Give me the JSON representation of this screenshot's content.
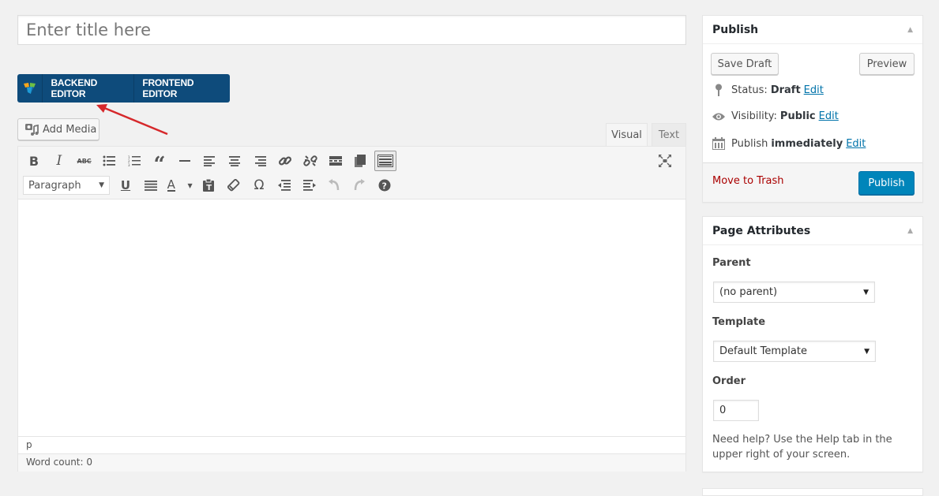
{
  "title": {
    "placeholder": "Enter title here",
    "value": ""
  },
  "composer": {
    "backend_label": "BACKEND EDITOR",
    "frontend_label": "FRONTEND EDITOR",
    "brand_color": "#0e4b7b"
  },
  "media": {
    "add_media_label": "Add Media"
  },
  "editor_tabs": [
    {
      "label": "Visual",
      "active": true
    },
    {
      "label": "Text",
      "active": false
    }
  ],
  "toolbar": {
    "row1": [
      "bold",
      "italic",
      "strikethrough",
      "bulleted-list",
      "numbered-list",
      "blockquote",
      "horizontal-line",
      "align-left",
      "align-center",
      "align-right",
      "insert-link",
      "remove-link",
      "read-more",
      "copy",
      "toolbar-toggle"
    ],
    "row2": [
      "underline",
      "justify",
      "text-color",
      "paste-as-text",
      "clear-formatting",
      "special-character",
      "decrease-indent",
      "increase-indent",
      "undo",
      "redo",
      "help"
    ],
    "format_select_value": "Paragraph"
  },
  "editor": {
    "content": "",
    "path": "p",
    "word_count_label": "Word count: 0"
  },
  "publish": {
    "title": "Publish",
    "save_draft_label": "Save Draft",
    "preview_label": "Preview",
    "status_label": "Status:",
    "status_value": "Draft",
    "visibility_label": "Visibility:",
    "visibility_value": "Public",
    "schedule_label": "Publish",
    "schedule_value": "immediately",
    "edit_label": "Edit",
    "trash_label": "Move to Trash",
    "publish_label": "Publish",
    "publish_color": "#0085ba",
    "trash_color": "#a00000"
  },
  "page_attributes": {
    "title": "Page Attributes",
    "parent_label": "Parent",
    "parent_value": "(no parent)",
    "template_label": "Template",
    "template_value": "Default Template",
    "order_label": "Order",
    "order_value": "0",
    "help_text": "Need help? Use the Help tab in the upper right of your screen."
  }
}
